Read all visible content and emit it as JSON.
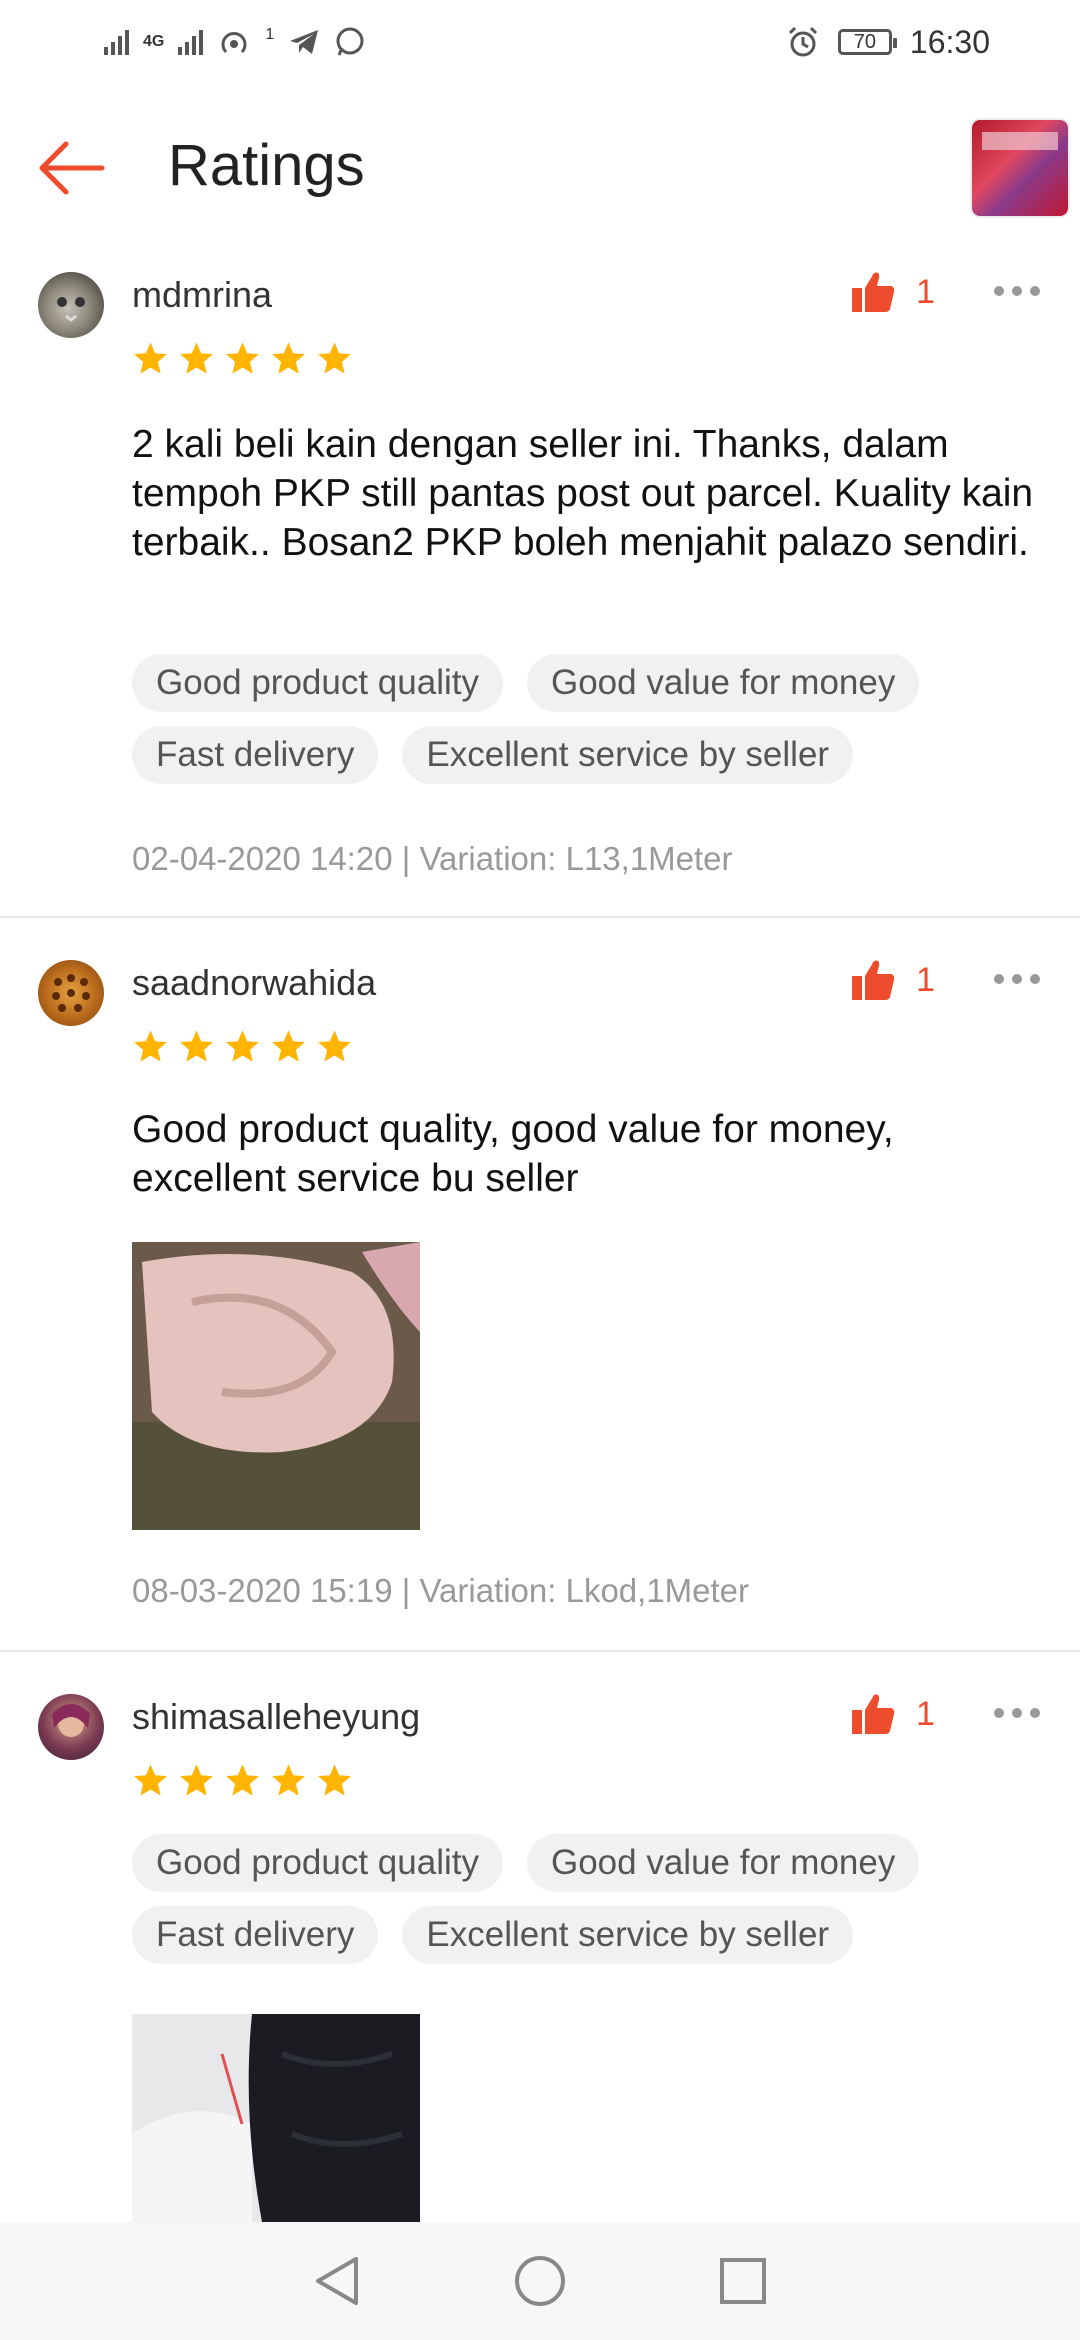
{
  "status_bar": {
    "network_label": "4G",
    "notification_count": "1",
    "battery": "70",
    "time": "16:30"
  },
  "app_bar": {
    "title": "Ratings"
  },
  "reviews": [
    {
      "username": "mdmrina",
      "likes": "1",
      "stars": 5,
      "comment": "2 kali beli kain dengan seller ini. Thanks, dalam tempoh PKP still pantas post out parcel. Kuality kain terbaik.. Bosan2 PKP boleh menjahit palazo sendiri.",
      "tags": [
        "Good product quality",
        "Good value for money",
        "Fast delivery",
        "Excellent service by seller"
      ],
      "meta": "02-04-2020 14:20 | Variation: L13,1Meter"
    },
    {
      "username": "saadnorwahida",
      "likes": "1",
      "stars": 5,
      "comment": "Good product quality, good value for money, excellent service bu seller",
      "meta": "08-03-2020 15:19 | Variation: Lkod,1Meter"
    },
    {
      "username": "shimasalleheyung",
      "likes": "1",
      "stars": 5,
      "tags": [
        "Good product quality",
        "Good value for money",
        "Fast delivery",
        "Excellent service by seller"
      ]
    }
  ],
  "colors": {
    "accent": "#ee4d2d",
    "star": "#ffb400"
  }
}
